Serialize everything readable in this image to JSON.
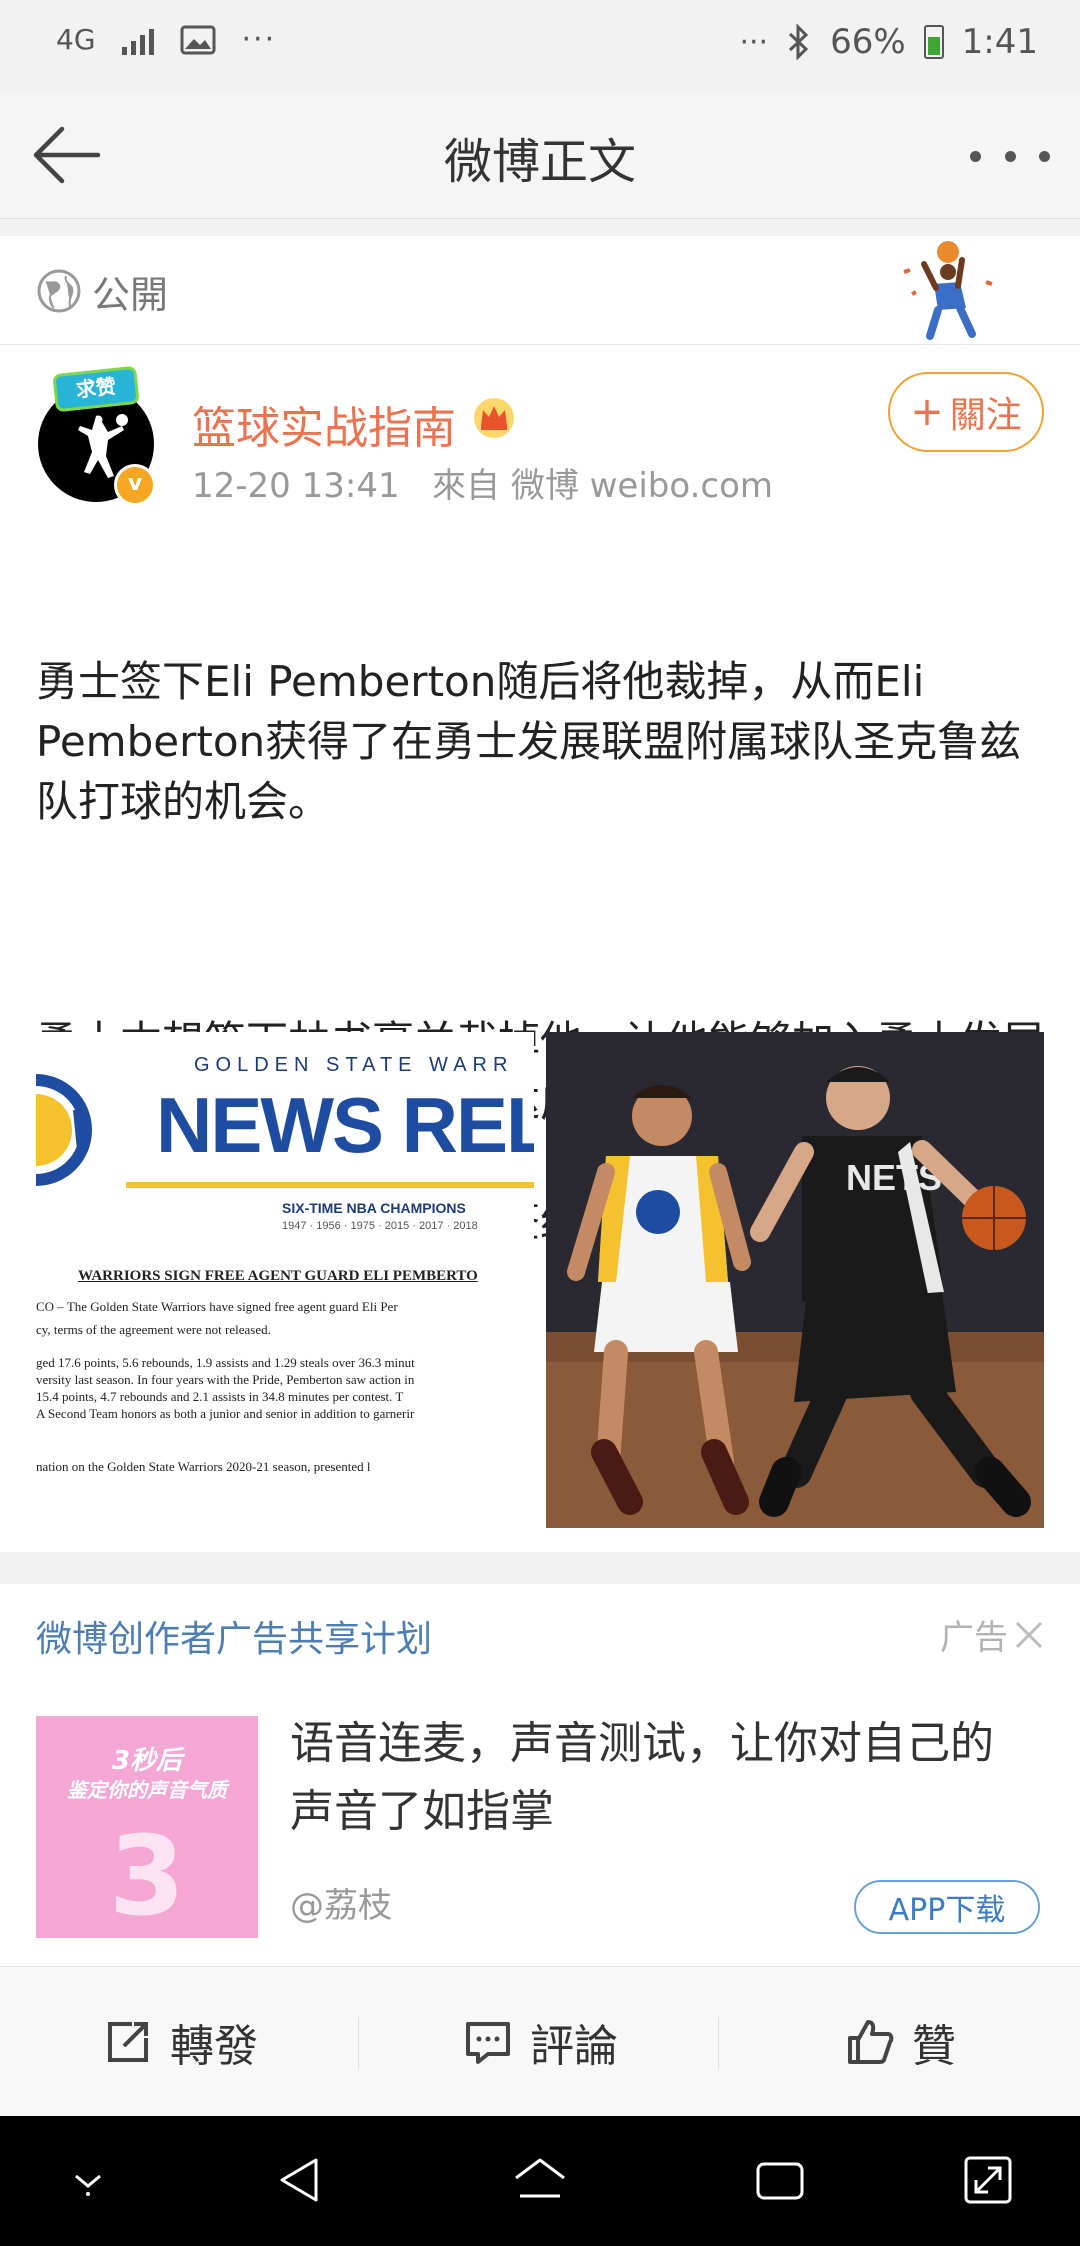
{
  "status_bar": {
    "network": "4G",
    "battery_percent": "66%",
    "time": "1:41"
  },
  "nav": {
    "title": "微博正文"
  },
  "visibility": {
    "label": "公開"
  },
  "author": {
    "avatar_tag": "求赞",
    "name": "篮球实战指南",
    "verified_badge": "v",
    "meta": "12-20 13:41   來自 微博 weibo.com",
    "follow_label": "關注"
  },
  "post": {
    "paragraphs": [
      "勇士签下Eli Pemberton随后将他裁掉，从而Eli Pemberton获得了在勇士发展联盟附属球队圣克鲁兹队打球的机会。",
      "勇士本想签下林书豪并裁掉他，让他能够加入勇士发展联盟球队，各项条款已经达成一致。但要达成这笔签约，需要来自FIBA澄清信，而FIBA办公室在周末不会办公，书豪错过了最后的签约时间。"
    ],
    "news_image": {
      "org": "GOLDEN STATE WARR",
      "headline": "NEWS RELE",
      "champions": "SIX-TIME NBA CHAMPIONS",
      "years": "1947 · 1956 · 1975 · 2015 · 2017 · 2018",
      "subheading": "WARRIORS SIGN FREE AGENT GUARD ELI PEMBERTO",
      "lines": [
        "CO – The Golden State Warriors have signed free agent guard Eli Per",
        "cy, terms of the agreement were not released.",
        "ged 17.6 points, 5.6 rebounds, 1.9 assists and 1.29 steals over 36.3 minut",
        "versity last season. In four years with the Pride, Pemberton saw action in",
        "15.4 points, 4.7 rebounds and 2.1 assists in 34.8 minutes per contest. T",
        "A Second Team honors as both a junior and senior in addition to garnerir",
        "nation on the Golden State Warriors 2020-21 season, presented l"
      ]
    },
    "photo_jersey": "NETS"
  },
  "ad": {
    "header": "微博创作者广告共享计划",
    "label": "广告",
    "thumb_line1": "3秒后",
    "thumb_line2": "鉴定你的声音气质",
    "thumb_number": "3",
    "title": "语音连麦，声音测试，让你对自己的声音了如指掌",
    "source": "@荔枝",
    "app_button": "APP下载"
  },
  "actions": {
    "repost": "轉發",
    "comment": "評論",
    "like": "贊"
  },
  "colors": {
    "orange": "#eb7350",
    "link_blue": "#4d7db3",
    "warriors_blue": "#1d4ca0",
    "warriors_gold": "#f3c22c"
  }
}
